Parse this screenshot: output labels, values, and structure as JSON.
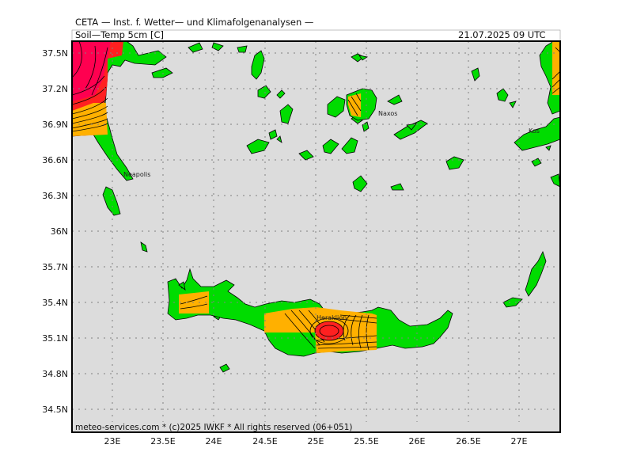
{
  "header": {
    "institute": "CETA — Inst. f. Wetter— und Klimafolgenanalysen —",
    "variable": "Soil—Temp 5cm [C]",
    "datetime": "21.07.2025 09 UTC",
    "footer": "meteo-services.com * (c)2025 IWKF * All rights reserved (06+051)"
  },
  "map": {
    "lon_range": [
      22.6,
      27.4
    ],
    "lat_range": [
      34.3,
      37.6
    ],
    "x_ticks": [
      "23E",
      "23.5E",
      "24E",
      "24.5E",
      "25E",
      "25.5E",
      "26E",
      "26.5E",
      "27E"
    ],
    "y_ticks": [
      "37.5N",
      "37.2N",
      "36.9N",
      "36.6N",
      "36.3N",
      "36N",
      "35.7N",
      "35.4N",
      "35.1N",
      "34.8N",
      "34.5N"
    ],
    "place_labels": [
      "Naxos",
      "Neapolis",
      "Kos",
      "Heraklion"
    ],
    "colors": {
      "sea": "#dcdcdc",
      "land": "#00dc00",
      "warm": "#ffb000",
      "hot": "#ff2020",
      "hotter": "#ff0050",
      "contour": "#000000",
      "grid": "#808080"
    }
  }
}
